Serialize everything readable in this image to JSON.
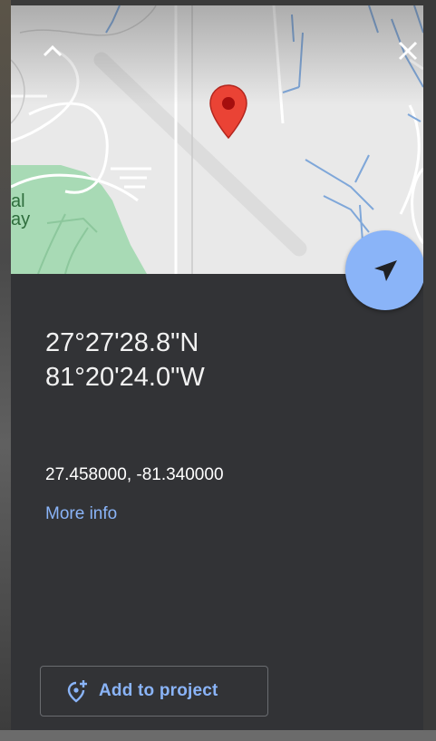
{
  "map": {
    "area_label_lines": [
      "al",
      "ay"
    ],
    "marker_color": "#ea4335",
    "marker_icon": "red-pin-icon"
  },
  "controls": {
    "collapse_icon": "chevron-up-icon",
    "close_icon": "close-icon",
    "directions_icon": "directions-arrow-icon",
    "directions_color": "#8ab4f8"
  },
  "place": {
    "lat_dms": "27°27'28.8\"N",
    "lng_dms": "81°20'24.0\"W",
    "decimal_coords": "27.458000, -81.340000",
    "more_info_label": "More info"
  },
  "actions": {
    "add_to_project_label": "Add to project",
    "add_to_project_icon": "add-location-icon"
  },
  "colors": {
    "panel_background": "#323336",
    "accent": "#8ab4f8"
  }
}
